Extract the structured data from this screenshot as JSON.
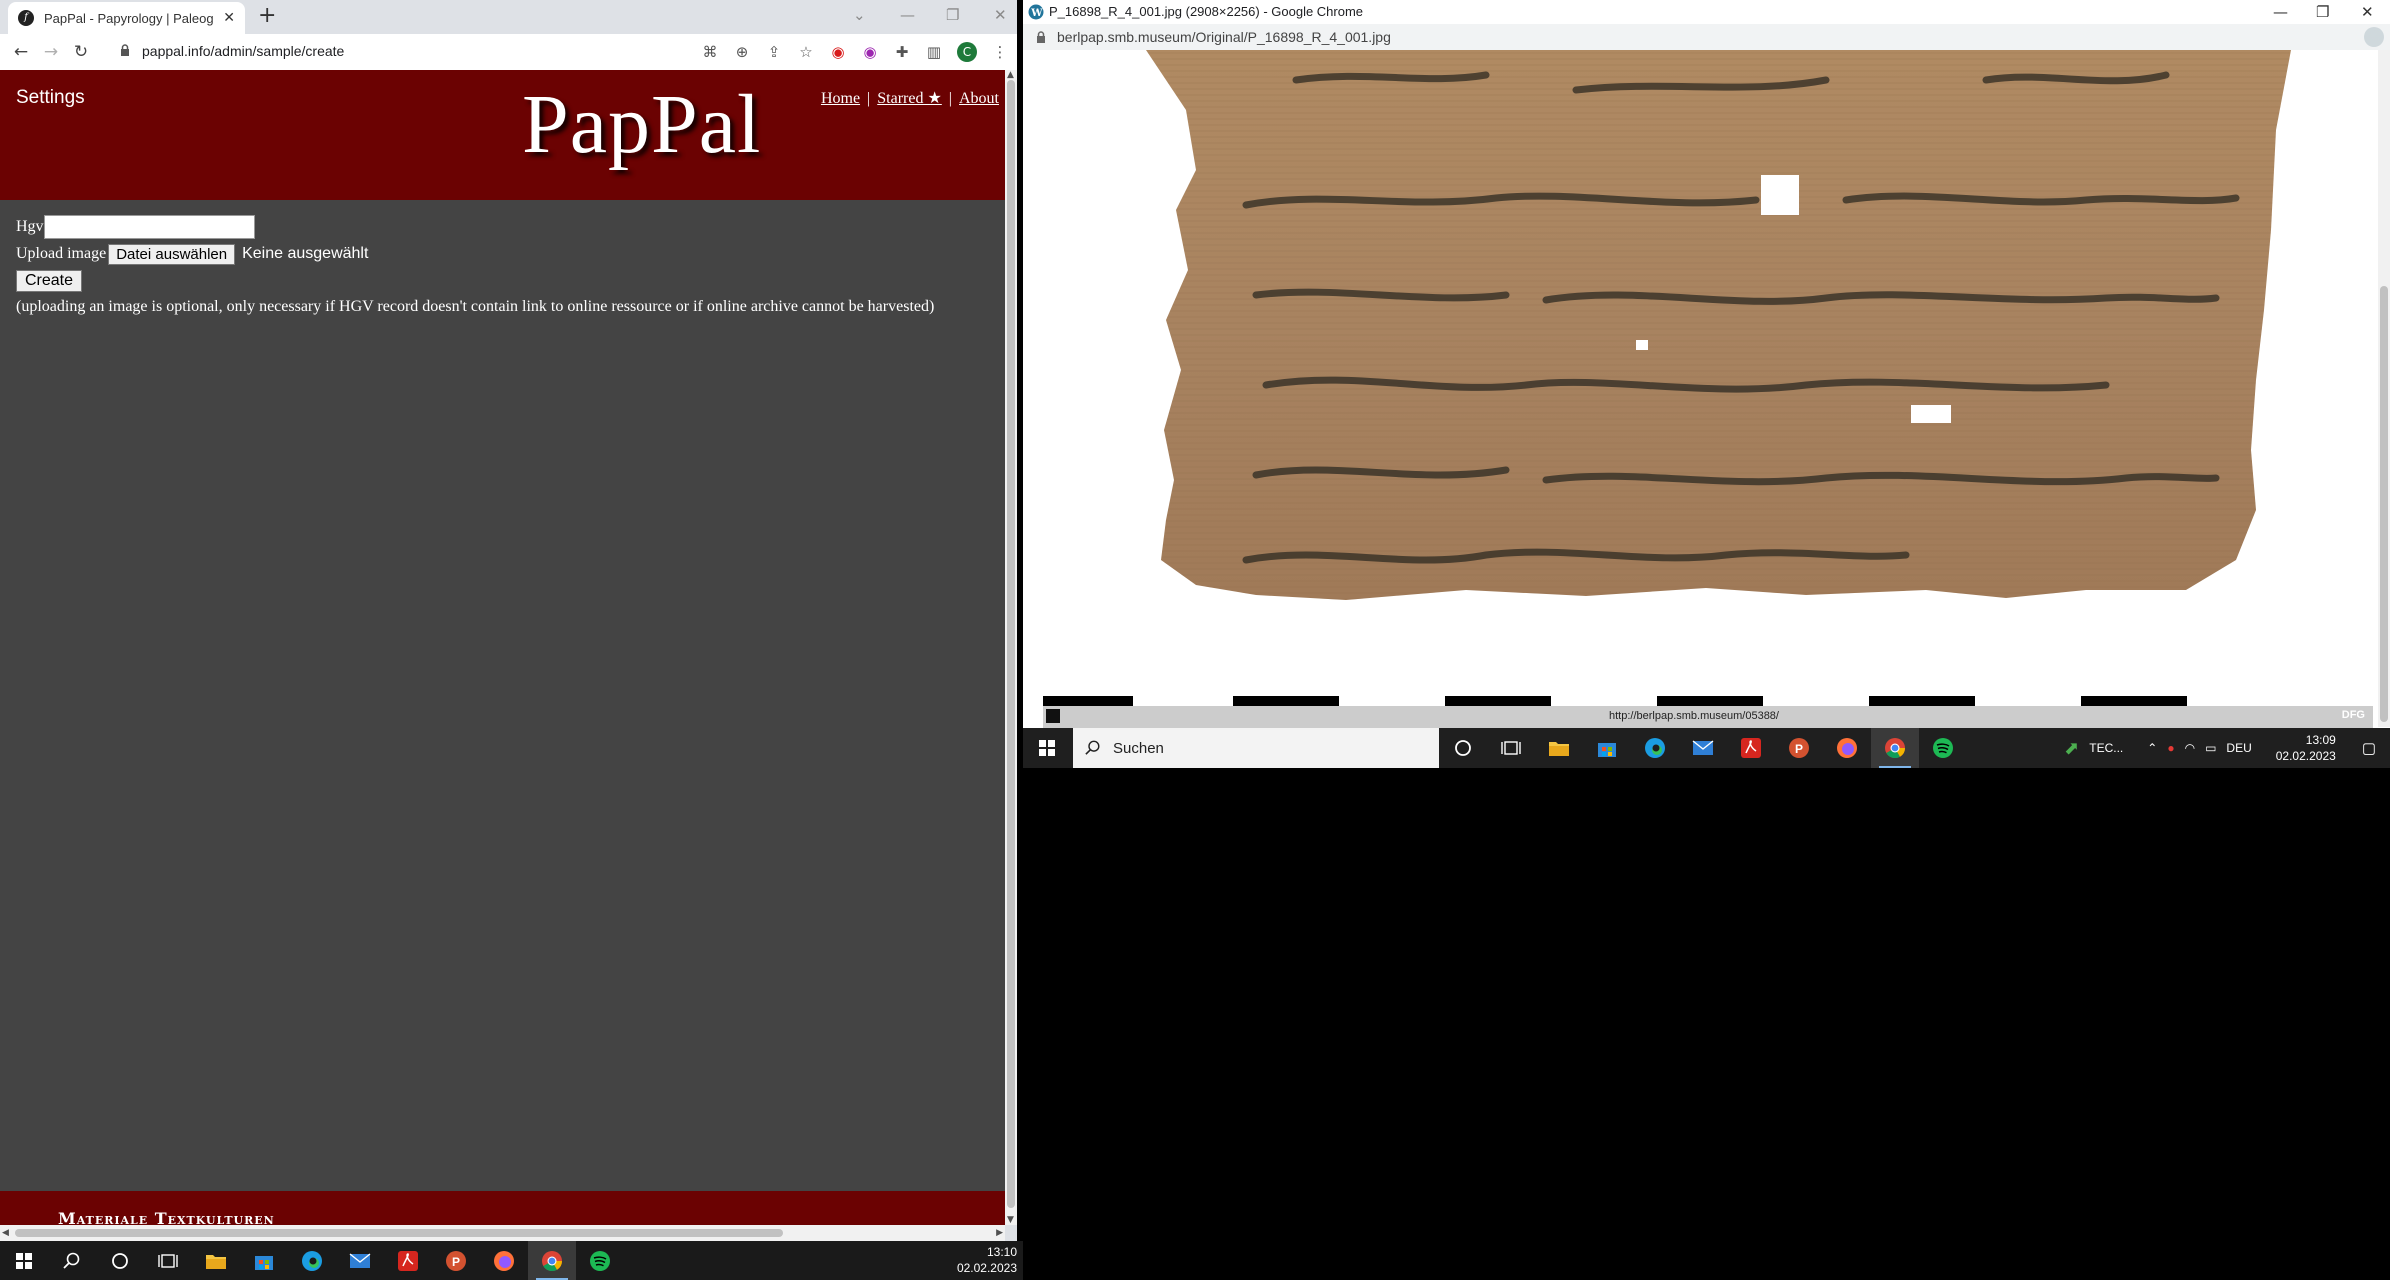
{
  "left_browser": {
    "tab": {
      "title": "PapPal - Papyrology | Paleography",
      "close": "✕",
      "favicon": "f"
    },
    "new_tab": "+",
    "window_controls": {
      "minimize": "—",
      "restore": "❐",
      "close": "✕"
    },
    "nav": {
      "back": "←",
      "forward": "→",
      "reload": "↻"
    },
    "address": "pappal.info/admin/sample/create",
    "profile_initial": "C"
  },
  "site": {
    "settings_label": "Settings",
    "logo": "PapPal",
    "nav": {
      "home": "Home",
      "starred": "Starred ★",
      "about": "About",
      "separator": "|"
    },
    "form": {
      "hgv_label": "Hgv",
      "hgv_value": "",
      "upload_label": "Upload image",
      "choose_file": "Datei auswählen",
      "file_status": "Keine ausgewählt",
      "create": "Create",
      "note": "(uploading an image is optional, only necessary if HGV record doesn't contain link to online ressource or if online archive cannot be harvested)"
    },
    "footer_text": "Materiale Textkulturen"
  },
  "left_taskbar": {
    "time": "13:10",
    "date": "02.02.2023"
  },
  "right_browser": {
    "title": "P_16898_R_4_001.jpg (2908×2256) - Google Chrome",
    "address": "berlpap.smb.museum/Original/P_16898_R_4_001.jpg",
    "image_footer_url": "http://berlpap.smb.museum/05388/",
    "image_footer_right": "DFG"
  },
  "right_taskbar": {
    "search_placeholder": "Suchen",
    "tray_app": "TEC...",
    "language": "DEU",
    "time": "13:09",
    "date": "02.02.2023"
  },
  "colors": {
    "site_header": "#6b0202",
    "site_body": "#444444",
    "taskbar": "#1a1a1a"
  }
}
